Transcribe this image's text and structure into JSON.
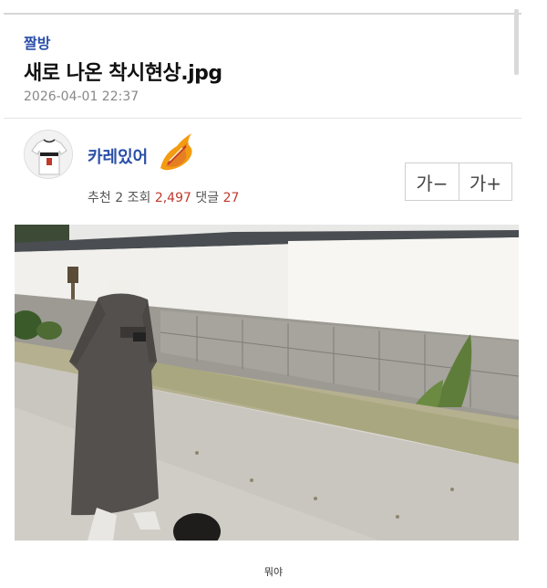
{
  "post": {
    "board": "짤방",
    "title": "새로 나온 착시현상.jpg",
    "date": "2026-04-01 22:37"
  },
  "author": {
    "nickname": "카레있어",
    "avatar_icon": "jersey-avatar-icon",
    "badge_icon": "flame-badge-icon"
  },
  "stats": {
    "recommend_label": "추천",
    "recommend_value": "2",
    "views_label": "조회",
    "views_value": "2,497",
    "comments_label": "댓글",
    "comments_value": "27"
  },
  "font_controls": {
    "decrease_label": "가−",
    "increase_label": "가+"
  },
  "content": {
    "image_icon": "photo",
    "caption": "뭐야"
  },
  "colors": {
    "link_blue": "#2a4fa8",
    "count_red": "#c0392b"
  }
}
